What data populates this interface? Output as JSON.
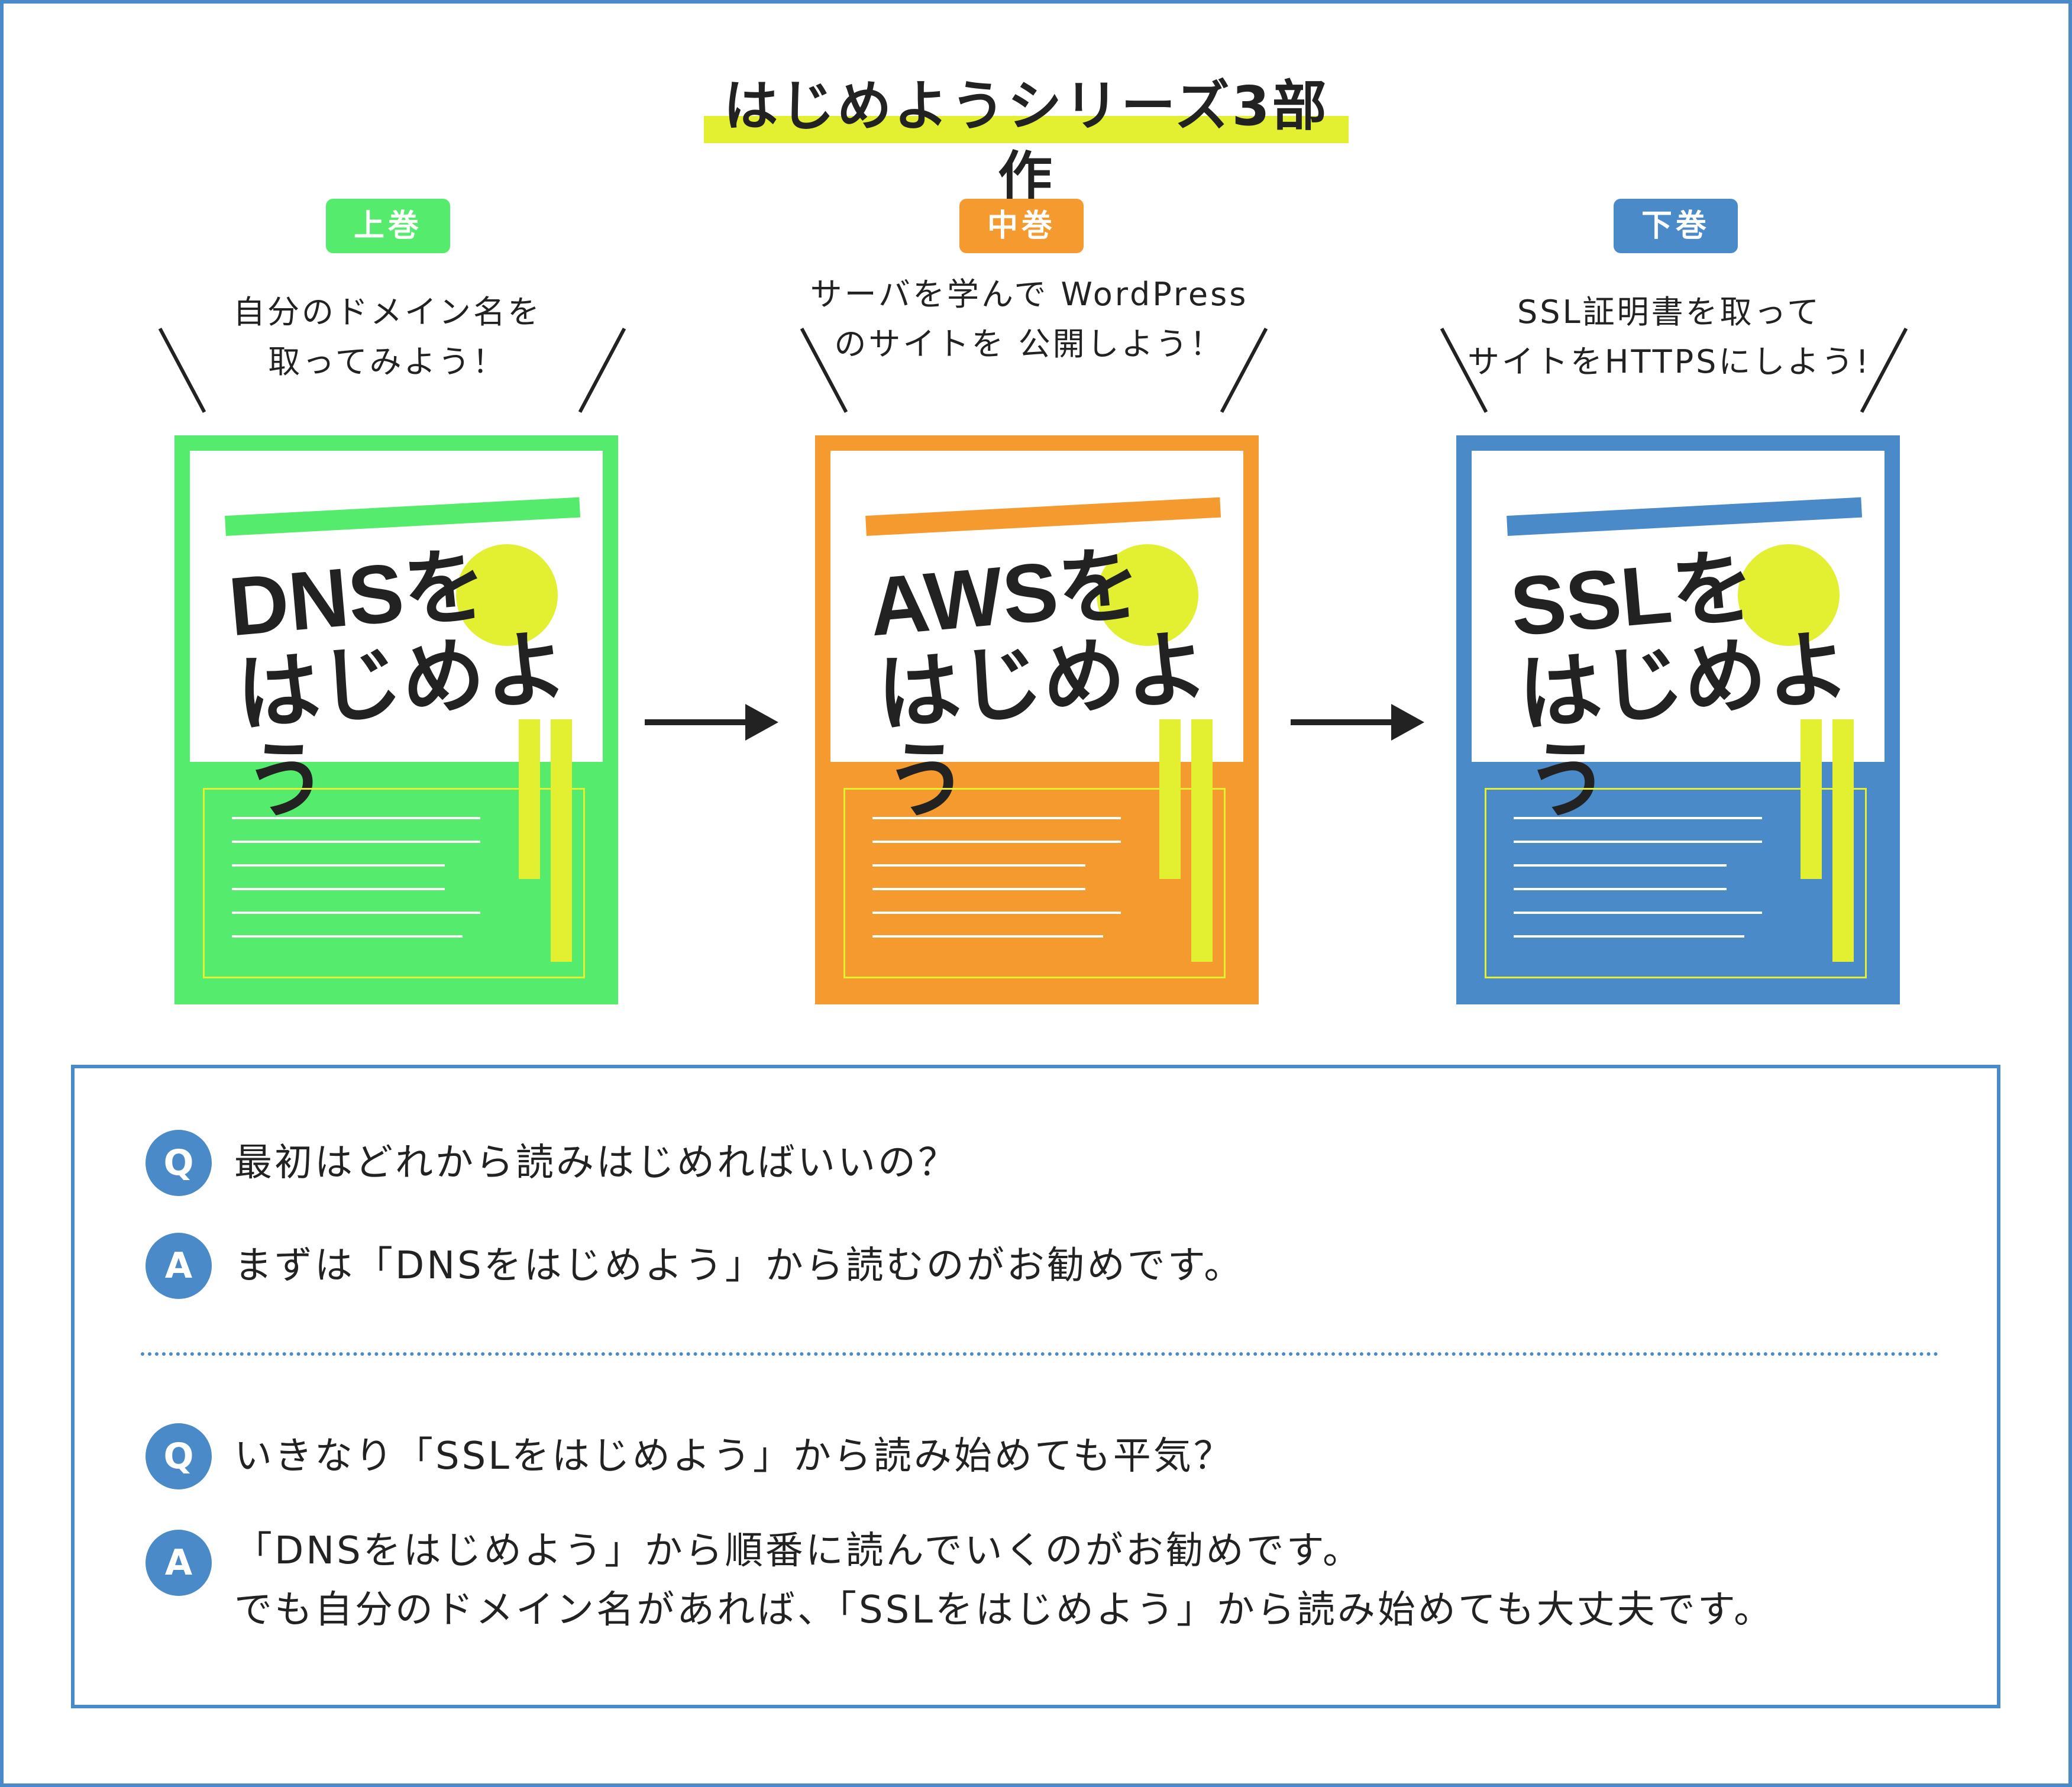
{
  "page_title": "はじめようシリーズ3部作",
  "colors": {
    "frame": "#4b8ac9",
    "highlight": "#e3ef31",
    "green": "#55ec6e",
    "orange": "#f59a2f",
    "blue": "#4b8ac9"
  },
  "volumes": [
    {
      "badge": "上巻",
      "description": "自分のドメイン名を\n取ってみよう！",
      "book_title": "DNSを\nはじめよう",
      "color": "#55ec6e"
    },
    {
      "badge": "中巻",
      "description": "サーバを学んで\nWordPressのサイトを\n公開しよう！",
      "book_title": "AWSを\nはじめよう",
      "color": "#f59a2f"
    },
    {
      "badge": "下巻",
      "description": "SSL証明書を取って\nサイトをHTTPSにしよう!",
      "book_title": "SSLを\nはじめよう",
      "color": "#4b8ac9"
    }
  ],
  "qa": [
    {
      "q_icon": "Q",
      "question": "最初はどれから読みはじめればいいの？",
      "a_icon": "A",
      "answer": "まずは「DNSをはじめよう」から読むのがお勧めです。"
    },
    {
      "q_icon": "Q",
      "question": "いきなり「SSLをはじめよう」から読み始めても平気？",
      "a_icon": "A",
      "answer": "「DNSをはじめよう」から順番に読んでいくのがお勧めです。\nでも自分のドメイン名があれば、「SSLをはじめよう」から読み始めても大丈夫です。"
    }
  ]
}
